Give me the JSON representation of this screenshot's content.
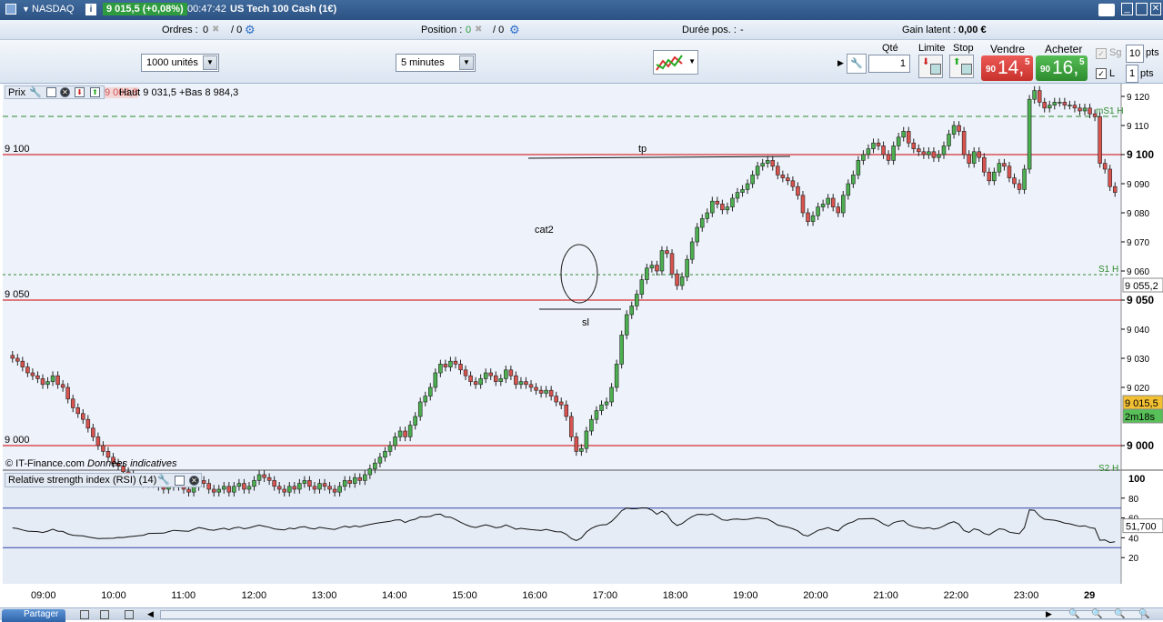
{
  "titlebar": {
    "instrument": "NASDAQ",
    "quote": "9 015,5 (+0,08%)",
    "time": "00:47:42",
    "name": "US Tech 100 Cash (1€)"
  },
  "infobar": {
    "orders_label": "Ordres :",
    "orders_value": "0",
    "orders_total": "/ 0",
    "position_label": "Position :",
    "position_value": "0",
    "position_total": "/ 0",
    "duration_label": "Durée pos. :",
    "duration_value": "-",
    "gain_label": "Gain latent :",
    "gain_value": "0,00 €"
  },
  "toolbar": {
    "units": "1000 unités",
    "timeframe": "5 minutes",
    "qty_label": "Qté",
    "qty_value": "1",
    "limit_label": "Limite",
    "stop_label": "Stop",
    "sell_label": "Vendre",
    "sell_prefix": "90",
    "sell_price": "14,",
    "sell_suffix": "5",
    "buy_label": "Acheter",
    "buy_prefix": "90",
    "buy_price": "16,",
    "buy_suffix": "5",
    "sg_label": "Sg",
    "sg_pts": "10",
    "pts_label": "pts",
    "l_label": "L",
    "l_pts": "1",
    "pts_label2": "pts"
  },
  "price_panel": {
    "title": "Prix",
    "ohlc": "Haut 9 031,5 +Bas 8 984,3",
    "ohlc_overlay": "9 006,8",
    "copyright": "© IT-Finance.com",
    "note": "Données indicatives",
    "level_labels": [
      "9 100",
      "9 050",
      "9 000"
    ],
    "annotations": {
      "tp": "tp",
      "cat2": "cat2",
      "sl": "sl"
    },
    "pivot_labels": {
      "ms1h": "mS1 H",
      "s1h": "S1 H",
      "s2h": "S2 H"
    },
    "price_axis": [
      "9 120",
      "9 110",
      "9 100",
      "9 090",
      "9 080",
      "9 070",
      "9 060",
      "9 050",
      "9 040",
      "9 030",
      "9 020",
      "9 000"
    ],
    "badges": {
      "level": "9 055,2",
      "last": "9 015,5",
      "countdown": "2m18s"
    }
  },
  "rsi_panel": {
    "title": "Relative strength index (RSI) (14)",
    "axis": [
      "100",
      "80",
      "60",
      "40",
      "20"
    ],
    "last_value": "51,700"
  },
  "x_axis": [
    "09:00",
    "10:00",
    "11:00",
    "12:00",
    "13:00",
    "14:00",
    "15:00",
    "16:00",
    "17:00",
    "18:00",
    "19:00",
    "20:00",
    "21:00",
    "22:00",
    "23:00",
    "29"
  ],
  "bottombar": {
    "share_label": "Partager"
  },
  "colors": {
    "up": "#4caf50",
    "down": "#d9534f",
    "sell_bg": "#d9413c",
    "buy_bg": "#3c9d3c",
    "level_line": "#d00000",
    "pivot": "#2e8b2e"
  }
}
